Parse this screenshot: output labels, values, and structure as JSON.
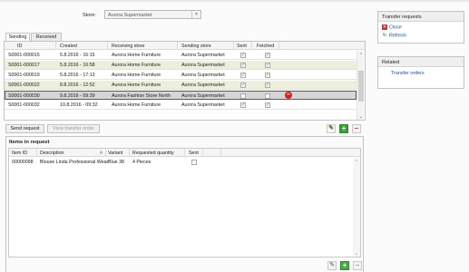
{
  "store": {
    "label": "Store:",
    "value": "Aurora Supermarket"
  },
  "tabs": [
    "Sending",
    "Received"
  ],
  "transfers": {
    "columns": [
      "ID",
      "Created",
      "Receiving store",
      "Sending store",
      "Sent",
      "Fetched"
    ],
    "rows": [
      {
        "id": "S0001-000015",
        "created": "5.8.2016 - 16:15",
        "receiving": "Aurora Home Furniture",
        "sending": "Aurora Supermarket",
        "sent": true,
        "fetched": true
      },
      {
        "id": "S0001-000017",
        "created": "5.8.2016 - 16:58",
        "receiving": "Aurora Home Furniture",
        "sending": "Aurora Supermarket",
        "sent": true,
        "fetched": true
      },
      {
        "id": "S0001-000019",
        "created": "5.8.2016 - 17:13",
        "receiving": "Aurora Home Furniture",
        "sending": "Aurora Supermarket",
        "sent": true,
        "fetched": true
      },
      {
        "id": "S0001-000022",
        "created": "8.8.2016 - 12:52",
        "receiving": "Aurora Home Furniture",
        "sending": "Aurora Supermarket",
        "sent": true,
        "fetched": true
      },
      {
        "id": "S0001-000030",
        "created": "9.8.2016 - 09:39",
        "receiving": "Aurora Fashion Store North",
        "sending": "Aurora Supermarket",
        "sent": false,
        "fetched": false
      },
      {
        "id": "S0001-000032",
        "created": "10.8.2016 - 09:32",
        "receiving": "Aurora Home Furniture",
        "sending": "Aurora Supermarket",
        "sent": true,
        "fetched": true
      }
    ]
  },
  "buttons": {
    "send_request": "Send request",
    "view_transfer_order": "View transfer order"
  },
  "items": {
    "title": "Items in request",
    "columns": [
      "Item ID",
      "Description",
      "Variant",
      "Requested quantity",
      "Sent"
    ],
    "rows": [
      {
        "item_id": "00000098",
        "description": "Blouse Linda Professional Wear",
        "variant": "Blue 38",
        "quantity": "4 Pieces",
        "sent": false
      }
    ]
  },
  "side": {
    "panel1_title": "Transfer requests",
    "close": "Close",
    "refresh": "Refresh",
    "panel2_title": "Related",
    "transfer_orders": "Transfer orders"
  },
  "icons": {
    "close": "close-icon",
    "refresh": "refresh-icon",
    "edit": "pencil-icon",
    "add": "plus-icon",
    "remove": "minus-icon"
  },
  "colors": {
    "row_highlight": "#eeeedc",
    "selected_row": "#d6d6d6",
    "link": "#1c4fa0",
    "add_green": "#3aa03a",
    "remove_red": "#d23232"
  }
}
